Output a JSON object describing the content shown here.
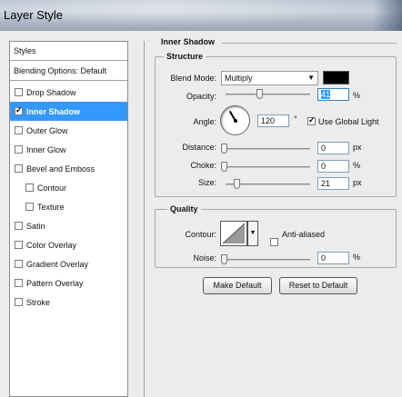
{
  "window": {
    "title": "Layer Style"
  },
  "left_panel": {
    "header": "Styles",
    "blending": "Blending Options: Default",
    "items": [
      {
        "label": "Drop Shadow",
        "checked": false,
        "selected": false
      },
      {
        "label": "Inner Shadow",
        "checked": true,
        "selected": true
      },
      {
        "label": "Outer Glow",
        "checked": false,
        "selected": false
      },
      {
        "label": "Inner Glow",
        "checked": false,
        "selected": false
      },
      {
        "label": "Bevel and Emboss",
        "checked": false,
        "selected": false
      },
      {
        "label": "Contour",
        "checked": false,
        "selected": false
      },
      {
        "label": "Texture",
        "checked": false,
        "selected": false
      },
      {
        "label": "Satin",
        "checked": false,
        "selected": false
      },
      {
        "label": "Color Overlay",
        "checked": false,
        "selected": false
      },
      {
        "label": "Gradient Overlay",
        "checked": false,
        "selected": false
      },
      {
        "label": "Pattern Overlay",
        "checked": false,
        "selected": false
      },
      {
        "label": "Stroke",
        "checked": false,
        "selected": false
      }
    ]
  },
  "inner_shadow": {
    "title": "Inner Shadow",
    "structure": {
      "title": "Structure",
      "blend_mode_label": "Blend Mode:",
      "blend_mode_value": "Multiply",
      "blend_color": "#000000",
      "opacity_label": "Opacity:",
      "opacity_value": "41",
      "opacity_unit": "%",
      "angle_label": "Angle:",
      "angle_value": "120",
      "angle_unit": "°",
      "global_light_label": "Use Global Light",
      "global_light_checked": true,
      "distance_label": "Distance:",
      "distance_value": "0",
      "distance_unit": "px",
      "choke_label": "Choke:",
      "choke_value": "0",
      "choke_unit": "%",
      "size_label": "Size:",
      "size_value": "21",
      "size_unit": "px"
    },
    "quality": {
      "title": "Quality",
      "contour_label": "Contour:",
      "anti_aliased_label": "Anti-aliased",
      "anti_aliased_checked": false,
      "noise_label": "Noise:",
      "noise_value": "0",
      "noise_unit": "%"
    },
    "buttons": {
      "make_default": "Make Default",
      "reset_default": "Reset to Default"
    }
  }
}
